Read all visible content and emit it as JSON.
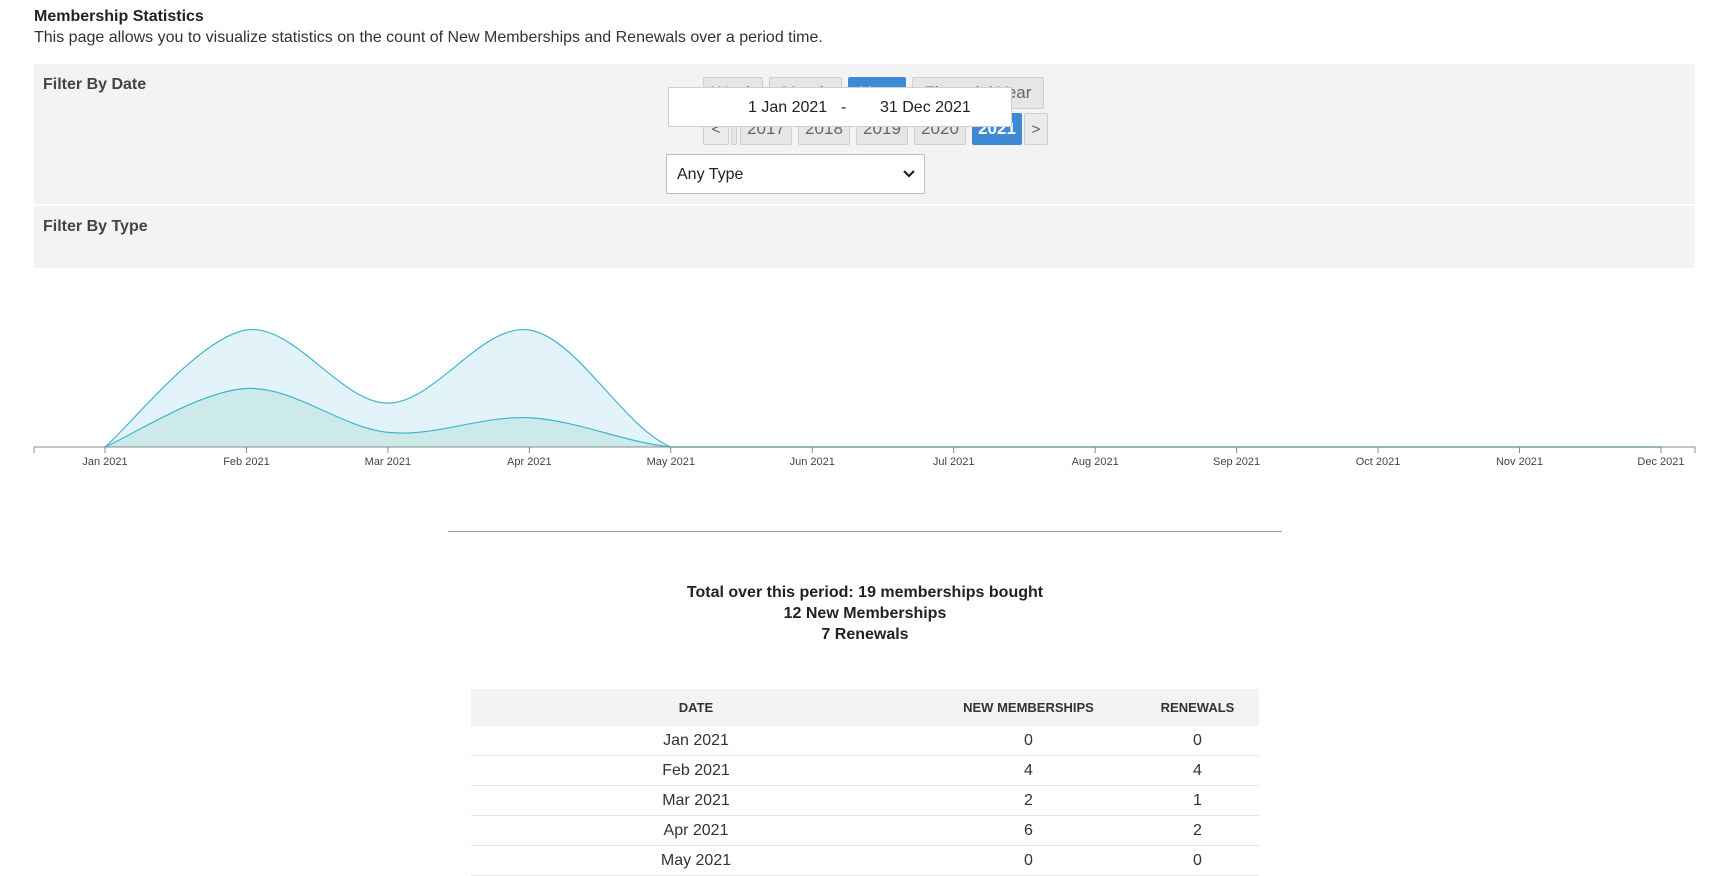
{
  "header": {
    "title": "Membership Statistics",
    "description": "This page allows you to visualize statistics on the count of New Memberships and Renewals over a period time."
  },
  "filters": {
    "date_label": "Filter By Date",
    "type_label": "Filter By Type",
    "period_buttons": [
      "Week",
      "Month",
      "Year",
      "Financial Year"
    ],
    "active_period": "Year",
    "prev_label": "<",
    "next_label": ">",
    "years": [
      "2017",
      "2018",
      "2019",
      "2020",
      "2021"
    ],
    "active_year": "2021",
    "range_start": "1 Jan 2021",
    "range_separator": "-",
    "range_end": "31 Dec 2021",
    "type_selected": "Any Type"
  },
  "colors": {
    "accent": "#3d8bd4",
    "series_stroke": "#3fb6cc",
    "series_fill_outer": "#e2f4f9",
    "series_fill_inner": "#cdeaeb"
  },
  "chart_data": {
    "type": "area",
    "categories": [
      "Jan 2021",
      "Feb 2021",
      "Mar 2021",
      "Apr 2021",
      "May 2021",
      "Jun 2021",
      "Jul 2021",
      "Aug 2021",
      "Sep 2021",
      "Oct 2021",
      "Nov 2021",
      "Dec 2021"
    ],
    "series": [
      {
        "values": [
          0,
          8,
          3,
          8,
          0,
          0,
          0,
          0,
          0,
          0,
          0,
          0
        ]
      },
      {
        "values": [
          0,
          4,
          1,
          2,
          0,
          0,
          0,
          0,
          0,
          0,
          0,
          0
        ]
      }
    ],
    "stacked": false,
    "grid": false,
    "legend": "none"
  },
  "summary": {
    "total_line": "Total over this period: 19 memberships bought",
    "new_line": "12 New Memberships",
    "renewals_line": "7 Renewals"
  },
  "table": {
    "headers": [
      "DATE",
      "NEW MEMBERSHIPS",
      "RENEWALS"
    ],
    "rows": [
      [
        "Jan 2021",
        "0",
        "0"
      ],
      [
        "Feb 2021",
        "4",
        "4"
      ],
      [
        "Mar 2021",
        "2",
        "1"
      ],
      [
        "Apr 2021",
        "6",
        "2"
      ],
      [
        "May 2021",
        "0",
        "0"
      ]
    ]
  }
}
